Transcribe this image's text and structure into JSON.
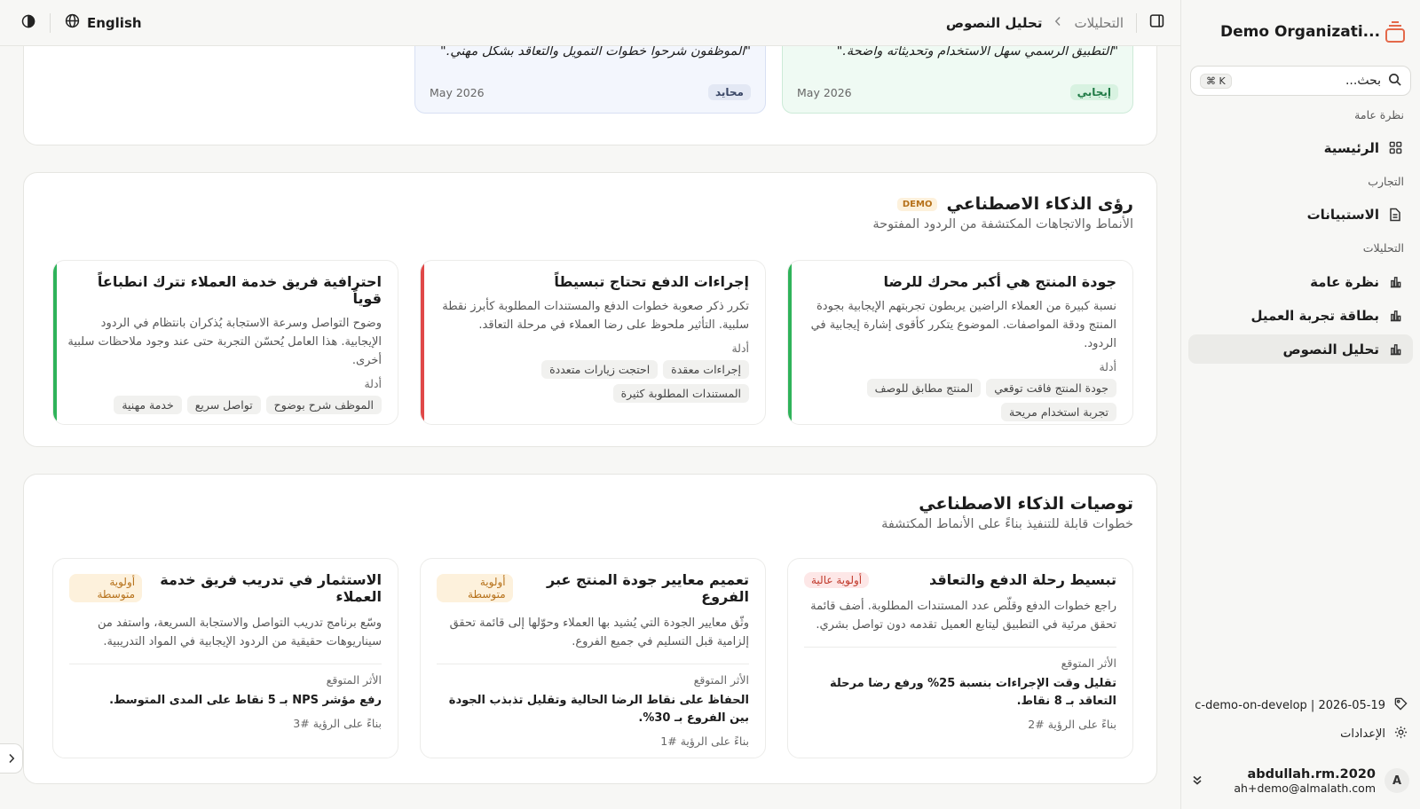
{
  "sidebar": {
    "org_name": "Demo Organizati...",
    "search_placeholder": "بحث...",
    "search_shortcut": "⌘ K",
    "sections": {
      "overview": "نظرة عامة",
      "experiences": "التجارب",
      "analytics": "التحليلات"
    },
    "items": {
      "home": "الرئيسية",
      "surveys": "الاستبيانات",
      "analytics_overview": "نظرة عامة",
      "cx_card": "بطاقة تجربة العميل",
      "text_analysis": "تحليل النصوص"
    },
    "build_info": "c-demo-on-develop | 2026-05-19",
    "settings": "الإعدادات",
    "user": {
      "initial": "A",
      "name": "abdullah.rm.2020",
      "email": "ah+demo@almalath.com"
    }
  },
  "topbar": {
    "language": "English",
    "breadcrumb_parent": "التحليلات",
    "breadcrumb_current": "تحليل النصوص"
  },
  "quotes": [
    {
      "text": "\"التطبيق الرسمي سهل الاستخدام وتحديثاته واضحة.\"",
      "sentiment": "إيجابي",
      "date": "May 2026"
    },
    {
      "text": "\"الموظفون شرحوا خطوات التمويل والتعاقد بشكل مهني.\"",
      "sentiment": "محايد",
      "date": "May 2026"
    }
  ],
  "insights_panel": {
    "title": "رؤى الذكاء الاصطناعي",
    "badge": "DEMO",
    "subtitle": "الأنماط والاتجاهات المكتشفة من الردود المفتوحة",
    "evidence_label": "أدلة",
    "cards": [
      {
        "title": "جودة المنتج هي أكبر محرك للرضا",
        "body": "نسبة كبيرة من العملاء الراضين يربطون تجربتهم الإيجابية بجودة المنتج ودقة المواصفات. الموضوع يتكرر كأقوى إشارة إيجابية في الردود.",
        "chips": [
          "جودة المنتج فاقت توقعي",
          "المنتج مطابق للوصف",
          "تجربة استخدام مريحة"
        ]
      },
      {
        "title": "إجراءات الدفع تحتاج تبسيطاً",
        "body": "تكرر ذكر صعوبة خطوات الدفع والمستندات المطلوبة كأبرز نقطة سلبية. التأثير ملحوظ على رضا العملاء في مرحلة التعاقد.",
        "chips": [
          "إجراءات معقدة",
          "احتجت زيارات متعددة",
          "المستندات المطلوبة كثيرة"
        ]
      },
      {
        "title": "احترافية فريق خدمة العملاء تترك انطباعاً قوياً",
        "body": "وضوح التواصل وسرعة الاستجابة يُذكران بانتظام في الردود الإيجابية. هذا العامل يُحسّن التجربة حتى عند وجود ملاحظات سلبية أخرى.",
        "chips": [
          "الموظف شرح بوضوح",
          "تواصل سريع",
          "خدمة مهنية"
        ]
      }
    ]
  },
  "recs_panel": {
    "title": "توصيات الذكاء الاصطناعي",
    "subtitle": "خطوات قابلة للتنفيذ بناءً على الأنماط المكتشفة",
    "impact_label": "الأثر المتوقع",
    "cards": [
      {
        "title": "تبسيط رحلة الدفع والتعاقد",
        "priority": "أولوية عالية",
        "body": "راجع خطوات الدفع وقلّص عدد المستندات المطلوبة. أضف قائمة تحقق مرئية في التطبيق ليتابع العميل تقدمه دون تواصل بشري.",
        "impact": "تقليل وقت الإجراءات بنسبة 25% ورفع رضا مرحلة التعاقد بـ 8 نقاط.",
        "basis": "بناءً على الرؤية #2"
      },
      {
        "title": "تعميم معايير جودة المنتج عبر الفروع",
        "priority": "أولوية متوسطة",
        "body": "وثّق معايير الجودة التي يُشيد بها العملاء وحوّلها إلى قائمة تحقق إلزامية قبل التسليم في جميع الفروع.",
        "impact": "الحفاظ على نقاط الرضا الحالية وتقليل تذبذب الجودة بين الفروع بـ 30%.",
        "basis": "بناءً على الرؤية #1"
      },
      {
        "title": "الاستثمار في تدريب فريق خدمة العملاء",
        "priority": "أولوية متوسطة",
        "body": "وسّع برنامج تدريب التواصل والاستجابة السريعة، واستفد من سيناريوهات حقيقية من الردود الإيجابية في المواد التدريبية.",
        "impact": "رفع مؤشر NPS بـ 5 نقاط على المدى المتوسط.",
        "basis": "بناءً على الرؤية #3"
      }
    ]
  },
  "colors": {
    "accent": "#e4694a",
    "positive": "#2fb35a",
    "negative": "#e04848",
    "medium": "#b6711a"
  }
}
